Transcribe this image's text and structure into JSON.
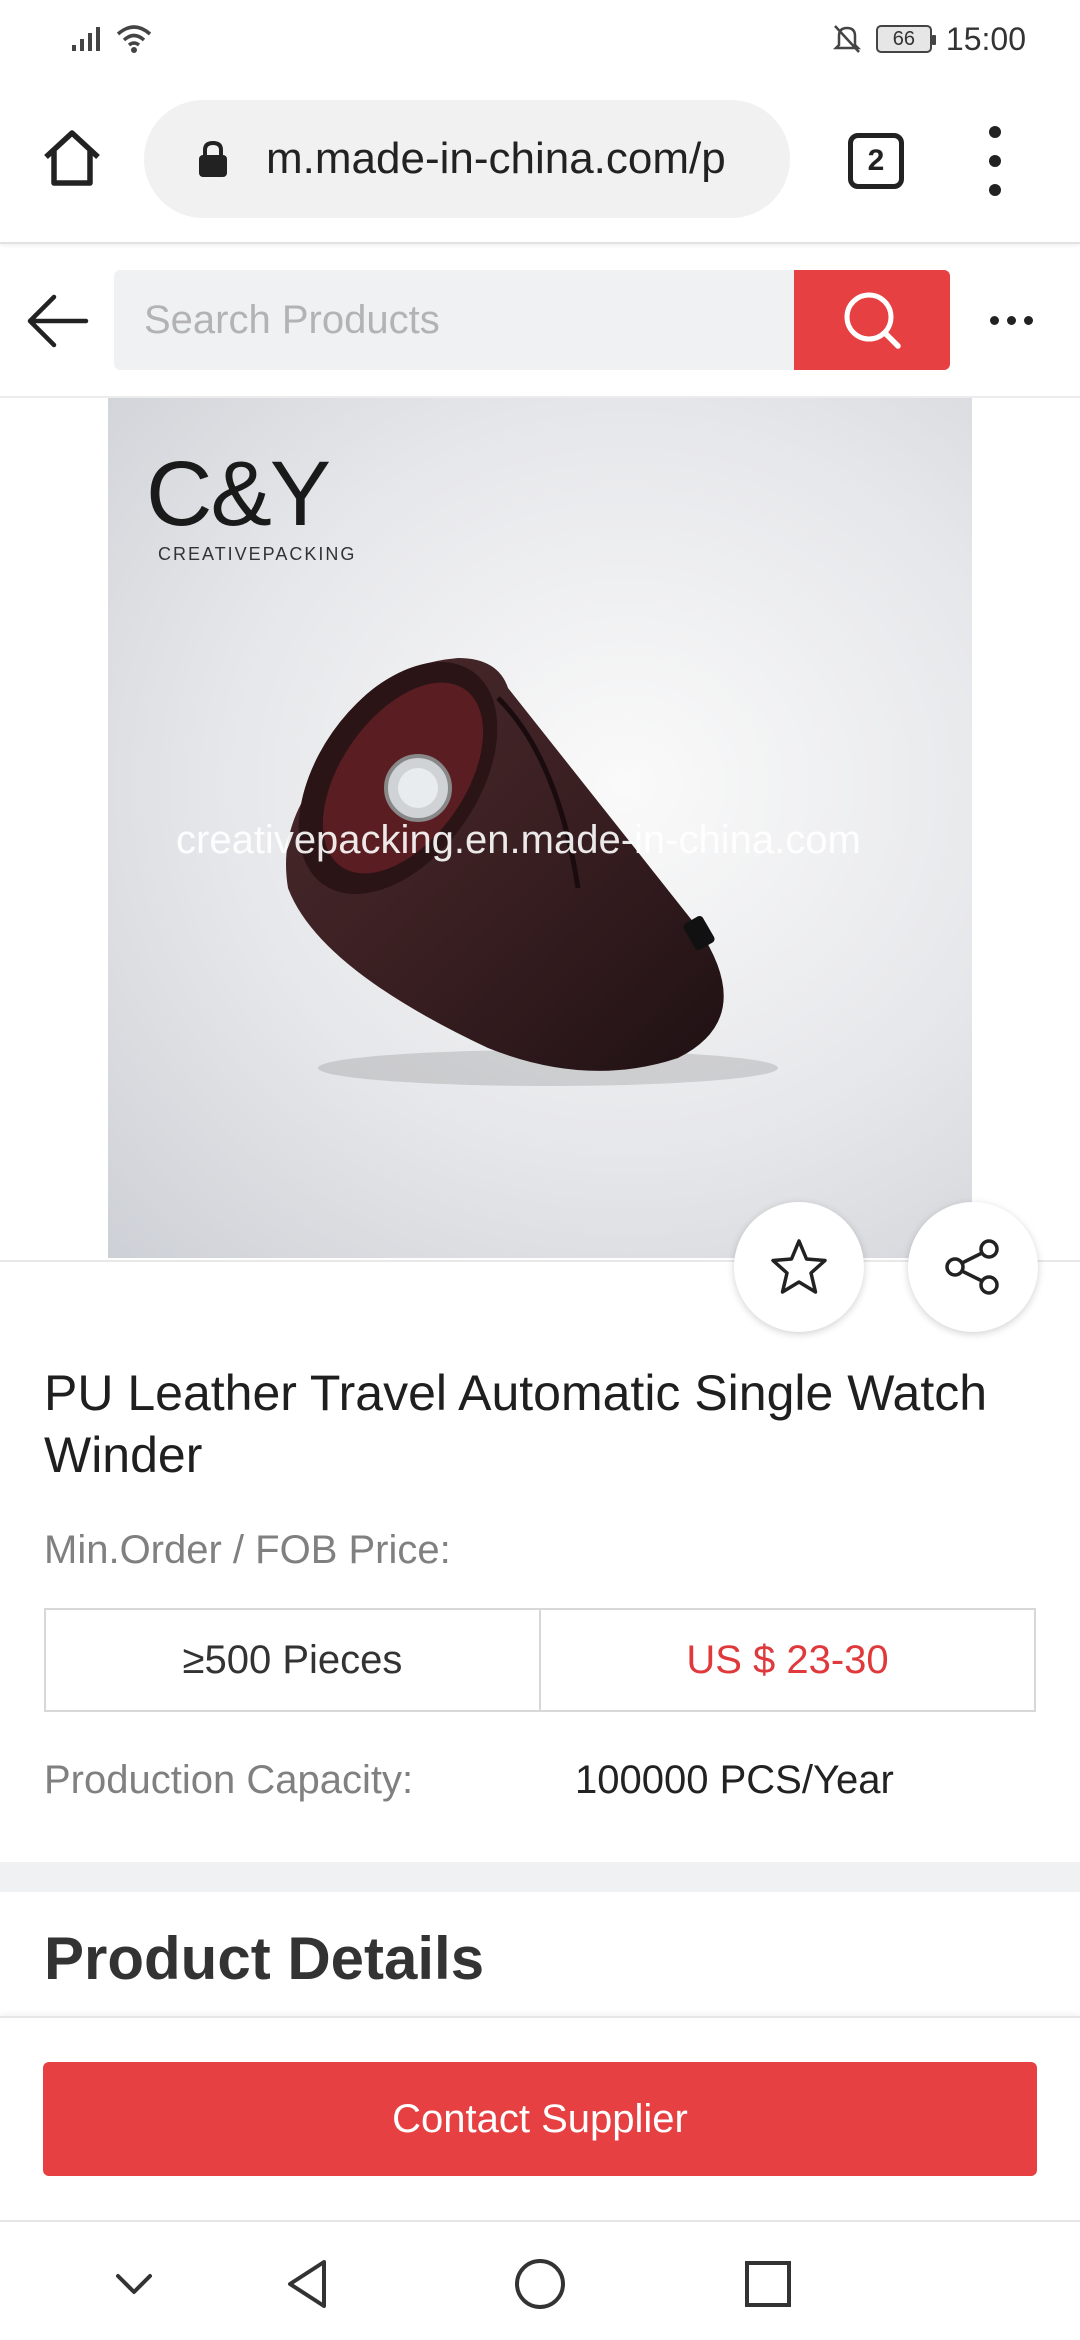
{
  "status_bar": {
    "battery": "66",
    "time": "15:00"
  },
  "browser": {
    "url": "m.made-in-china.com/p",
    "tab_count": "2"
  },
  "header": {
    "search_placeholder": "Search Products"
  },
  "product_image": {
    "logo_main": "C&Y",
    "logo_sub": "CREATIVEPACKING",
    "watermark": "creativepacking.en.made-in-china.com"
  },
  "product": {
    "title": "PU Leather Travel Automatic Single Watch Winder",
    "price_label": "Min.Order / FOB Price:",
    "min_order": "≥500 Pieces",
    "price": "US $ 23-30",
    "capacity_label": "Production Capacity:",
    "capacity_value": "100000 PCS/Year"
  },
  "details": {
    "section_title": "Product Details"
  },
  "cta": {
    "contact_label": "Contact Supplier"
  },
  "colors": {
    "accent": "#e64043",
    "price": "#e0393c"
  },
  "icons": [
    "signal-icon",
    "wifi-icon",
    "mute-icon",
    "battery-icon",
    "home-icon",
    "lock-icon",
    "tabs-icon",
    "menu-icon",
    "back-arrow-icon",
    "search-icon",
    "more-icon",
    "star-icon",
    "share-icon",
    "chevron-down-icon",
    "back-triangle-icon",
    "home-circle-icon",
    "recents-square-icon"
  ]
}
